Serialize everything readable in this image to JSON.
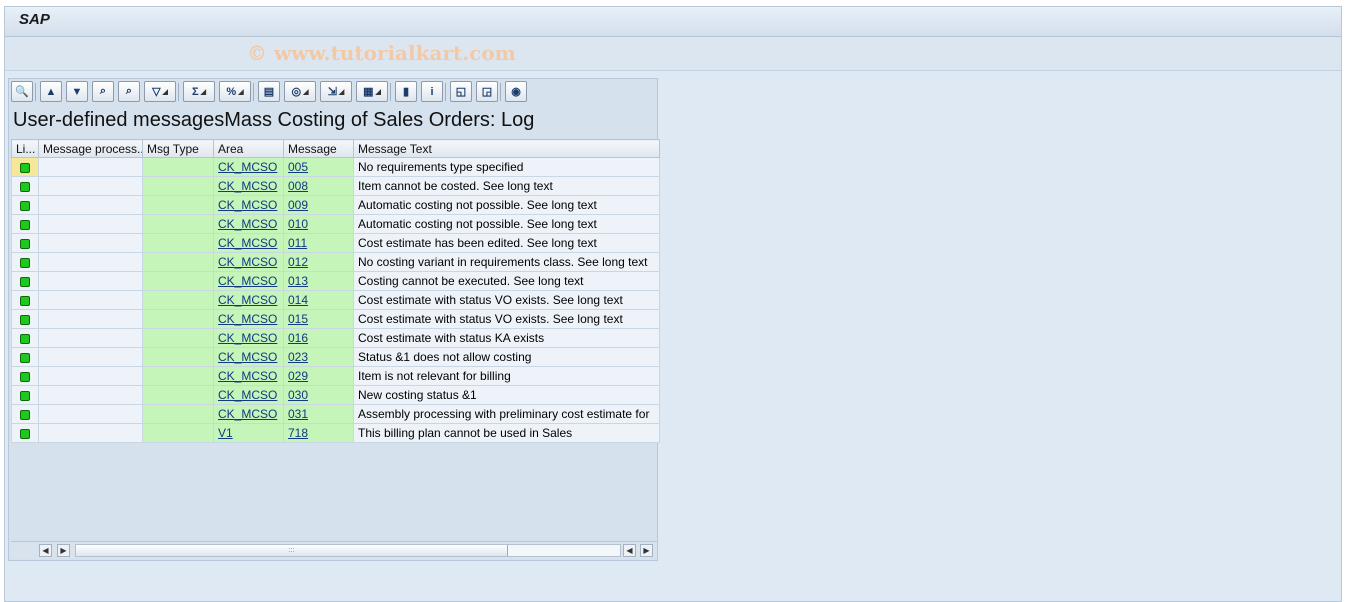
{
  "app": {
    "title": "SAP",
    "watermark": "© www.tutorialkart.com"
  },
  "grid": {
    "title": "User-defined messagesMass Costing of Sales Orders: Log",
    "columns": [
      "Li...",
      "Message process...",
      "Msg Type",
      "Area",
      "Message",
      "Message Text"
    ],
    "rows": [
      {
        "area": "CK_MCSO",
        "message": "005",
        "text": "No requirements type specified"
      },
      {
        "area": "CK_MCSO",
        "message": "008",
        "text": "Item cannot be costed. See long text"
      },
      {
        "area": "CK_MCSO",
        "message": "009",
        "text": "Automatic costing not possible. See long text"
      },
      {
        "area": "CK_MCSO",
        "message": "010",
        "text": "Automatic costing not possible. See long text"
      },
      {
        "area": "CK_MCSO",
        "message": "011",
        "text": "Cost estimate has been edited. See long text"
      },
      {
        "area": "CK_MCSO",
        "message": "012",
        "text": "No costing variant in requirements class. See long text"
      },
      {
        "area": "CK_MCSO",
        "message": "013",
        "text": "Costing cannot be executed. See long text"
      },
      {
        "area": "CK_MCSO",
        "message": "014",
        "text": "Cost estimate with status VO exists. See long text"
      },
      {
        "area": "CK_MCSO",
        "message": "015",
        "text": "Cost estimate with status VO exists. See long text"
      },
      {
        "area": "CK_MCSO",
        "message": "016",
        "text": "Cost estimate with status KA exists"
      },
      {
        "area": "CK_MCSO",
        "message": "023",
        "text": "Status &1 does not allow costing"
      },
      {
        "area": "CK_MCSO",
        "message": "029",
        "text": "Item is not relevant for billing"
      },
      {
        "area": "CK_MCSO",
        "message": "030",
        "text": "New costing status &1"
      },
      {
        "area": "CK_MCSO",
        "message": "031",
        "text": "Assembly processing with preliminary cost estimate for"
      },
      {
        "area": "V1",
        "message": "718",
        "text": "This billing plan cannot be used in Sales"
      }
    ]
  },
  "toolbar": {
    "buttons": [
      {
        "name": "details-icon",
        "glyph": "🔍"
      },
      {
        "name": "sort-ascending-icon",
        "glyph": "▲"
      },
      {
        "name": "sort-descending-icon",
        "glyph": "▼"
      },
      {
        "name": "find-icon",
        "glyph": "⌕"
      },
      {
        "name": "find-next-icon",
        "glyph": "⌕"
      },
      {
        "name": "filter-icon",
        "glyph": "▽",
        "dropdown": true
      },
      {
        "name": "sum-icon",
        "glyph": "Σ",
        "dropdown": true
      },
      {
        "name": "subtotal-icon",
        "glyph": "%",
        "dropdown": true
      },
      {
        "name": "print-preview-icon",
        "glyph": "▤"
      },
      {
        "name": "views-icon",
        "glyph": "◎",
        "dropdown": true
      },
      {
        "name": "export-icon",
        "glyph": "⇲",
        "dropdown": true
      },
      {
        "name": "layout-icon",
        "glyph": "▦",
        "dropdown": true
      },
      {
        "name": "graphic-icon",
        "glyph": "▮"
      },
      {
        "name": "info-icon",
        "glyph": "i"
      },
      {
        "name": "collapse-icon",
        "glyph": "◱"
      },
      {
        "name": "expand-icon",
        "glyph": "◲"
      },
      {
        "name": "legend-icon",
        "glyph": "◉"
      }
    ]
  },
  "colors": {
    "highlight": "#c5f5b8",
    "led": "#1ec81e"
  }
}
